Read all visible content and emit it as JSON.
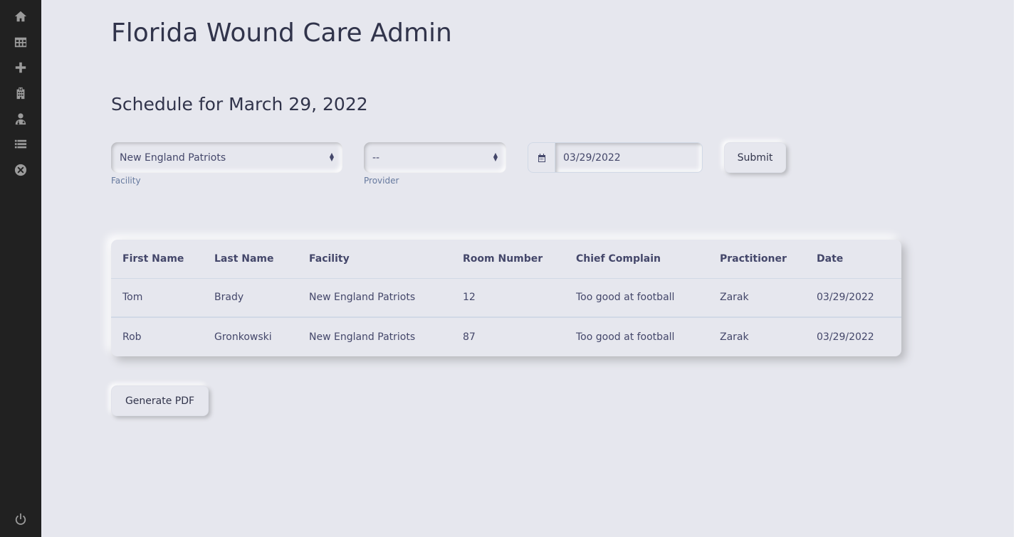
{
  "sidebar": {
    "items": [
      {
        "icon": "home-icon"
      },
      {
        "icon": "table-icon"
      },
      {
        "icon": "plus-icon"
      },
      {
        "icon": "hospital-icon"
      },
      {
        "icon": "doctor-icon"
      },
      {
        "icon": "list-icon"
      },
      {
        "icon": "close-circle-icon"
      }
    ],
    "bottom": {
      "icon": "power-icon"
    }
  },
  "header": {
    "title": "Florida Wound Care Admin"
  },
  "schedule": {
    "title": "Schedule for March 29, 2022"
  },
  "form": {
    "facility": {
      "value": "New England Patriots",
      "label": "Facility"
    },
    "provider": {
      "value": "--",
      "label": "Provider"
    },
    "date": {
      "value": "03/29/2022"
    },
    "submit": "Submit"
  },
  "table": {
    "columns": [
      "First Name",
      "Last Name",
      "Facility",
      "Room Number",
      "Chief Complain",
      "Practitioner",
      "Date"
    ],
    "rows": [
      [
        "Tom",
        "Brady",
        "New England Patriots",
        "12",
        "Too good at football",
        "Zarak",
        "03/29/2022"
      ],
      [
        "Rob",
        "Gronkowski",
        "New England Patriots",
        "87",
        "Too good at football",
        "Zarak",
        "03/29/2022"
      ]
    ]
  },
  "generate_pdf": "Generate PDF",
  "colors": {
    "background": "#e6e7ee",
    "sidebar": "#212121",
    "text": "#31344b"
  }
}
